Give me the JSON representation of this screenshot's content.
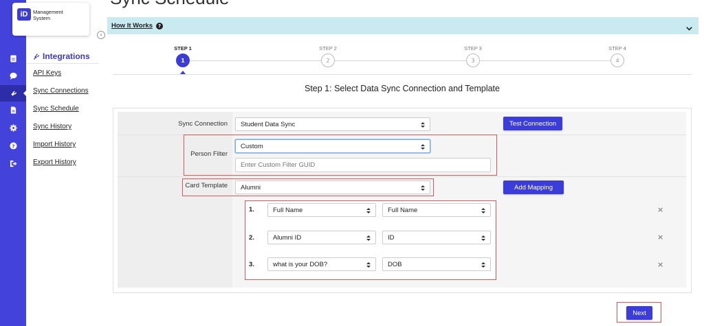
{
  "app": {
    "logo_badge": "iD",
    "logo_line1": "Management",
    "logo_line2": "System",
    "collapse_glyph": "‹"
  },
  "page": {
    "title": "Sync Schedule"
  },
  "rail_icons": [
    "id-card-icon",
    "chat-icon",
    "plug-icon",
    "document-icon",
    "gear-icon",
    "question-icon",
    "sign-out-icon"
  ],
  "sidebar": {
    "title": "Integrations",
    "items": [
      {
        "label": "API Keys"
      },
      {
        "label": "Sync Connections"
      },
      {
        "label": "Sync Schedule"
      },
      {
        "label": "Sync History"
      },
      {
        "label": "Import History"
      },
      {
        "label": "Export History"
      }
    ]
  },
  "how_it_works": {
    "label": "How It Works",
    "help_glyph": "?"
  },
  "stepper": {
    "steps": [
      {
        "label": "STEP 1",
        "number": "1",
        "active": true
      },
      {
        "label": "STEP 2",
        "number": "2",
        "active": false
      },
      {
        "label": "STEP 3",
        "number": "3",
        "active": false
      },
      {
        "label": "STEP 4",
        "number": "4",
        "active": false
      }
    ],
    "heading": "Step 1: Select Data Sync Connection and Template"
  },
  "form": {
    "sync_connection": {
      "label": "Sync Connection",
      "value": "Student Data Sync",
      "test_button": "Test Connection"
    },
    "person_filter": {
      "label": "Person Filter",
      "value": "Custom",
      "guid_placeholder": "Enter Custom Filter GUID"
    },
    "card_template": {
      "label": "Card Template",
      "value": "Alumni",
      "add_mapping_button": "Add Mapping"
    },
    "mappings": [
      {
        "number": "1.",
        "source": "Full Name",
        "target": "Full Name"
      },
      {
        "number": "2.",
        "source": "Alumni ID",
        "target": "ID"
      },
      {
        "number": "3.",
        "source": "what is your DOB?",
        "target": "DOB"
      }
    ],
    "remove_glyph": "×"
  },
  "footer": {
    "next_button": "Next"
  },
  "colors": {
    "accent": "#3c3cd8",
    "rail": "#4343dc",
    "highlight_box": "#e05555",
    "info_bar": "#c8eaf0"
  }
}
